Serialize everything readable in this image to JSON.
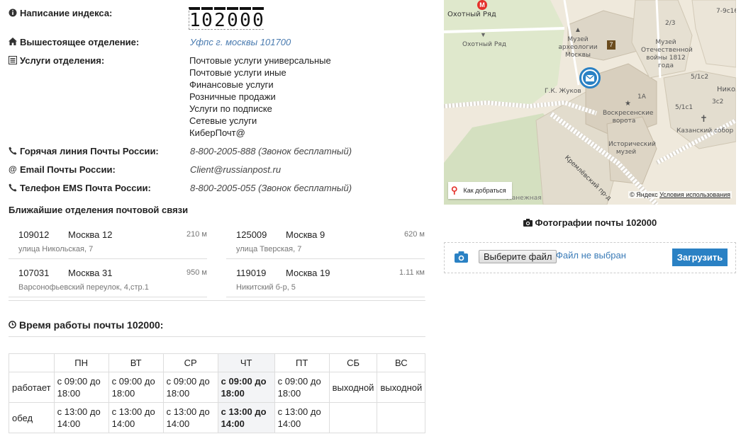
{
  "index_label": "Написание индекса:",
  "index_digits": [
    "1",
    "0",
    "2",
    "0",
    "0",
    "0"
  ],
  "parent_office": {
    "label": "Вышестоящее отделение:",
    "value": "Уфпс г. москвы 101700"
  },
  "services": {
    "label": "Услуги отделения:",
    "items": [
      "Почтовые услуги универсальные",
      "Почтовые услуги иные",
      "Финансовые услуги",
      "Розничные продажи",
      "Услуги по подписке",
      "Сетевые услуги",
      "КиберПочт@"
    ]
  },
  "hotline": {
    "label": "Горячая линия Почты России:",
    "value": "8-800-2005-888 (Звонок бесплатный)"
  },
  "email": {
    "label": "Email Почты России:",
    "value": "Client@russianpost.ru"
  },
  "ems": {
    "label": "Телефон EMS Почта России:",
    "value": "8-800-2005-055 (Звонок бесплатный)"
  },
  "nearest": {
    "title": "Ближайшие отделения почтовой связи",
    "offices": [
      {
        "index": "109012",
        "city": "Москва 12",
        "distance": "210 м",
        "street": "улица Никольская, 7"
      },
      {
        "index": "125009",
        "city": "Москва 9",
        "distance": "620 м",
        "street": "улица Тверская, 7"
      },
      {
        "index": "107031",
        "city": "Москва 31",
        "distance": "950 м",
        "street": "Варсонофьевский переулок, 4,стр.1"
      },
      {
        "index": "119019",
        "city": "Москва 19",
        "distance": "1.11 км",
        "street": "Никитский б-р, 5"
      }
    ]
  },
  "hours": {
    "title": "Время работы почты 102000:",
    "days": [
      "ПН",
      "ВТ",
      "СР",
      "ЧТ",
      "ПТ",
      "СБ",
      "ВС"
    ],
    "works_label": "работает",
    "lunch_label": "обед",
    "works": [
      "с 09:00 до 18:00",
      "с 09:00 до 18:00",
      "с 09:00 до 18:00",
      "с 09:00 до 18:00",
      "с 09:00 до 18:00",
      "выходной",
      "выходной"
    ],
    "lunch": [
      "с 13:00 до 14:00",
      "с 13:00 до 14:00",
      "с 13:00 до 14:00",
      "с 13:00 до 14:00",
      "с 13:00 до 14:00",
      "",
      ""
    ]
  },
  "map": {
    "labels": [
      "Охотный Ряд",
      "Охотный Ряд",
      "Музей археологии Москвы",
      "Музей Отечественной войны 1812 года",
      "Г.К. Жуков",
      "Воскресенские ворота",
      "Исторический музей",
      "Кремлёвский пр-д",
      "Казанский собор",
      "Манежная",
      "2/3",
      "7-9с16",
      "5/1с2",
      "5/1с1",
      "3с2",
      "Никол",
      "1А",
      "7",
      "М"
    ],
    "route_label": "Как добраться",
    "copyright": "© Яндекс",
    "terms": "Условия использования"
  },
  "photos": {
    "title": "Фотографии почты 102000",
    "choose_file": "Выберите файл",
    "no_file": "Файл не выбран",
    "upload": "Загрузить"
  },
  "colors": {
    "accent": "#2a81c4",
    "link": "#4a7bb0",
    "today_bg": "#f3f4f6"
  }
}
